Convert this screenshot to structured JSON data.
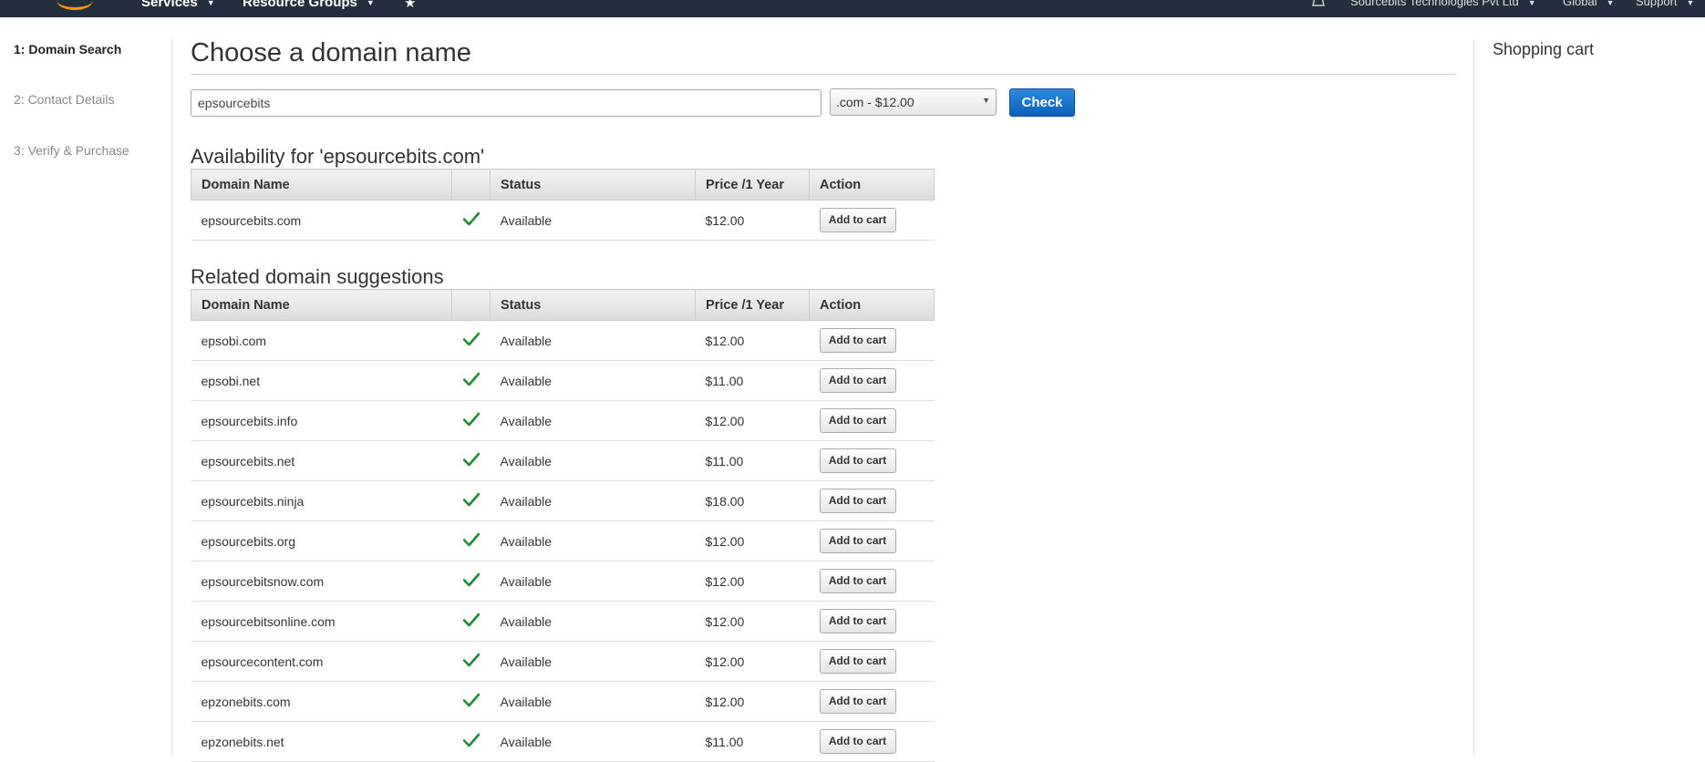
{
  "topbar": {
    "services_label": "Services",
    "resource_groups_label": "Resource Groups",
    "account_label": "Sourcebits Technologies Pvt Ltd",
    "region_label": "Global",
    "support_label": "Support",
    "colors": {
      "background": "#232f3e",
      "logo_accent": "#ff9900"
    }
  },
  "steps": [
    {
      "label": "1: Domain Search",
      "active": true
    },
    {
      "label": "2: Contact Details",
      "active": false
    },
    {
      "label": "3: Verify & Purchase",
      "active": false
    }
  ],
  "main": {
    "title": "Choose a domain name",
    "search": {
      "value": "epsourcebits"
    },
    "tld_select": {
      "selected": ".com - $12.00"
    },
    "check_label": "Check",
    "availability": {
      "heading": "Availability for 'epsourcebits.com'",
      "columns": [
        "Domain Name",
        "",
        "Status",
        "Price /1 Year",
        "Action"
      ],
      "rows": [
        {
          "domain": "epsourcebits.com",
          "status": "Available",
          "price": "$12.00",
          "action": "Add to cart"
        }
      ]
    },
    "suggestions": {
      "heading": "Related domain suggestions",
      "columns": [
        "Domain Name",
        "",
        "Status",
        "Price /1 Year",
        "Action"
      ],
      "rows": [
        {
          "domain": "epsobi.com",
          "status": "Available",
          "price": "$12.00",
          "action": "Add to cart"
        },
        {
          "domain": "epsobi.net",
          "status": "Available",
          "price": "$11.00",
          "action": "Add to cart"
        },
        {
          "domain": "epsourcebits.info",
          "status": "Available",
          "price": "$12.00",
          "action": "Add to cart"
        },
        {
          "domain": "epsourcebits.net",
          "status": "Available",
          "price": "$11.00",
          "action": "Add to cart"
        },
        {
          "domain": "epsourcebits.ninja",
          "status": "Available",
          "price": "$18.00",
          "action": "Add to cart"
        },
        {
          "domain": "epsourcebits.org",
          "status": "Available",
          "price": "$12.00",
          "action": "Add to cart"
        },
        {
          "domain": "epsourcebitsnow.com",
          "status": "Available",
          "price": "$12.00",
          "action": "Add to cart"
        },
        {
          "domain": "epsourcebitsonline.com",
          "status": "Available",
          "price": "$12.00",
          "action": "Add to cart"
        },
        {
          "domain": "epsourcecontent.com",
          "status": "Available",
          "price": "$12.00",
          "action": "Add to cart"
        },
        {
          "domain": "epzonebits.com",
          "status": "Available",
          "price": "$12.00",
          "action": "Add to cart"
        },
        {
          "domain": "epzonebits.net",
          "status": "Available",
          "price": "$11.00",
          "action": "Add to cart"
        }
      ]
    },
    "status_icon": "checkmark-icon",
    "colors": {
      "check_button": "#0b5fb8",
      "available_check": "#1d8a34"
    }
  },
  "cart": {
    "title": "Shopping cart"
  }
}
